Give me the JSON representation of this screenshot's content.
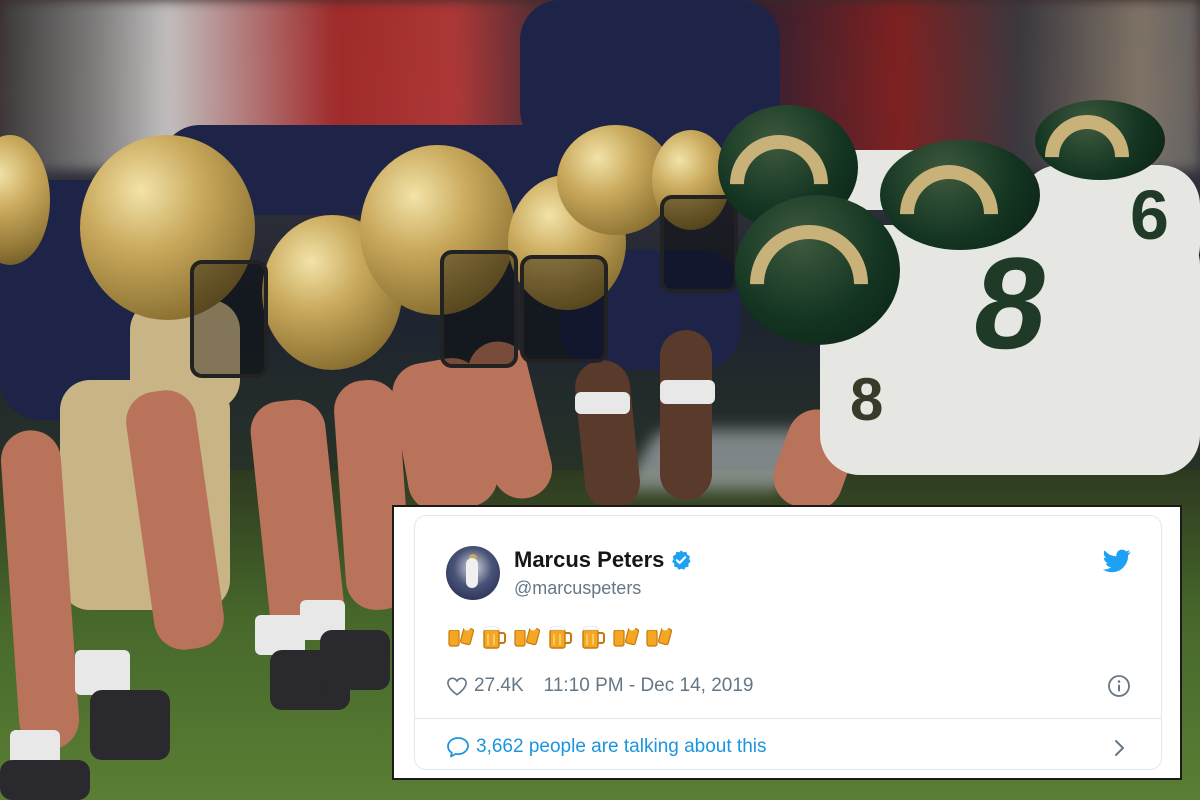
{
  "tweet": {
    "display_name": "Marcus Peters",
    "handle": "@marcuspeters",
    "emojis": [
      "beer-mugs",
      "beer-mug",
      "beer-mugs",
      "beer-mug",
      "beer-mug",
      "beer-mugs",
      "beer-mugs"
    ],
    "likes": "27.4K",
    "timestamp": "11:10 PM - Dec 14, 2019",
    "talking": "3,662 people are talking about this"
  },
  "colors": {
    "verified_blue": "#1da1f2",
    "link_blue": "#1b95e0",
    "meta_gray": "#657786",
    "name_black": "#14171a"
  },
  "icons": {
    "verified": "verified-badge-icon",
    "brand": "twitter-bird-icon",
    "like": "heart-icon",
    "info": "info-icon",
    "reply": "speech-bubble-icon",
    "more": "chevron-right-icon"
  }
}
